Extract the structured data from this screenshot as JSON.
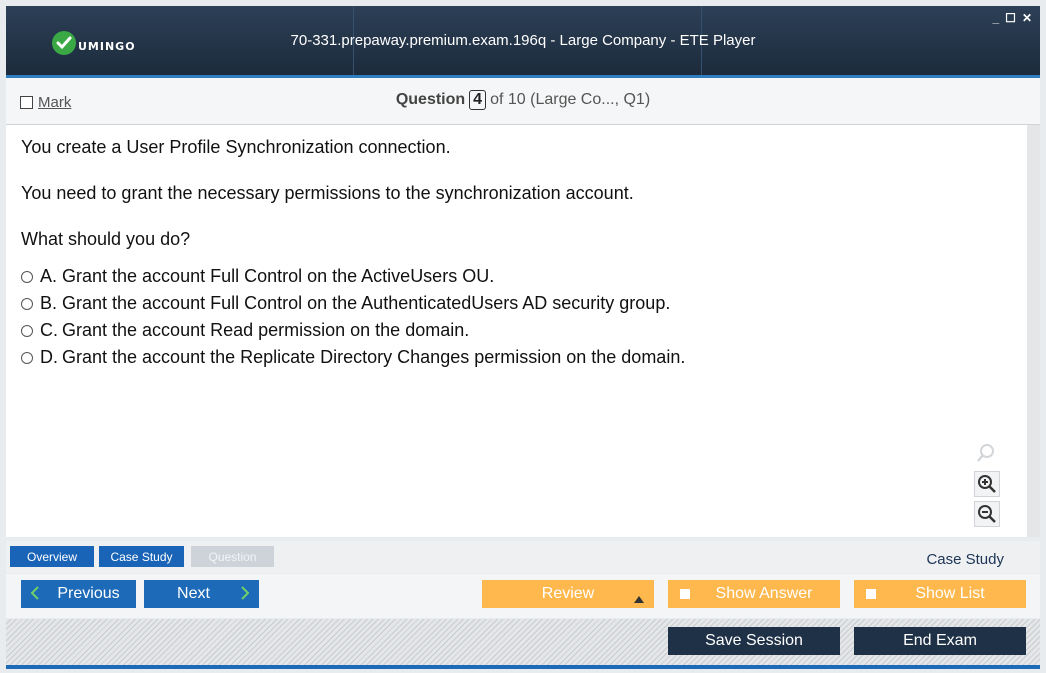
{
  "app": {
    "logo_text": "UMINGO",
    "window_title": "70-331.prepaway.premium.exam.196q - Large Company - ETE Player",
    "controls": {
      "minimize": "_",
      "maximize": "☐",
      "close": "✕"
    }
  },
  "header": {
    "mark_label": "Mark",
    "question_label": "Question",
    "question_number": "4",
    "question_of": "of 10 (Large Co..., Q1)"
  },
  "question": {
    "paragraphs": [
      "You create a User Profile Synchronization connection.",
      "You need to grant the necessary permissions to the synchronization account.",
      "What should you do?"
    ],
    "options": [
      {
        "letter": "A.",
        "text": "Grant the account Full Control on the ActiveUsers OU."
      },
      {
        "letter": "B.",
        "text": "Grant the account Full Control on the AuthenticatedUsers AD security group."
      },
      {
        "letter": "C.",
        "text": "Grant the account Read permission on the domain."
      },
      {
        "letter": "D.",
        "text": "Grant the account the Replicate Directory Changes permission on the domain."
      }
    ]
  },
  "tabs": {
    "overview": "Overview",
    "case_study": "Case Study",
    "question": "Question",
    "section_label": "Case Study"
  },
  "nav": {
    "previous": "Previous",
    "next": "Next",
    "review": "Review",
    "show_answer": "Show Answer",
    "show_list": "Show List"
  },
  "bottom": {
    "save_session": "Save Session",
    "end_exam": "End Exam"
  },
  "colors": {
    "accent_blue": "#1d6ab8",
    "orange": "#ffb84d",
    "dark_navy": "#1e3147",
    "logo_green": "#3aa845"
  }
}
